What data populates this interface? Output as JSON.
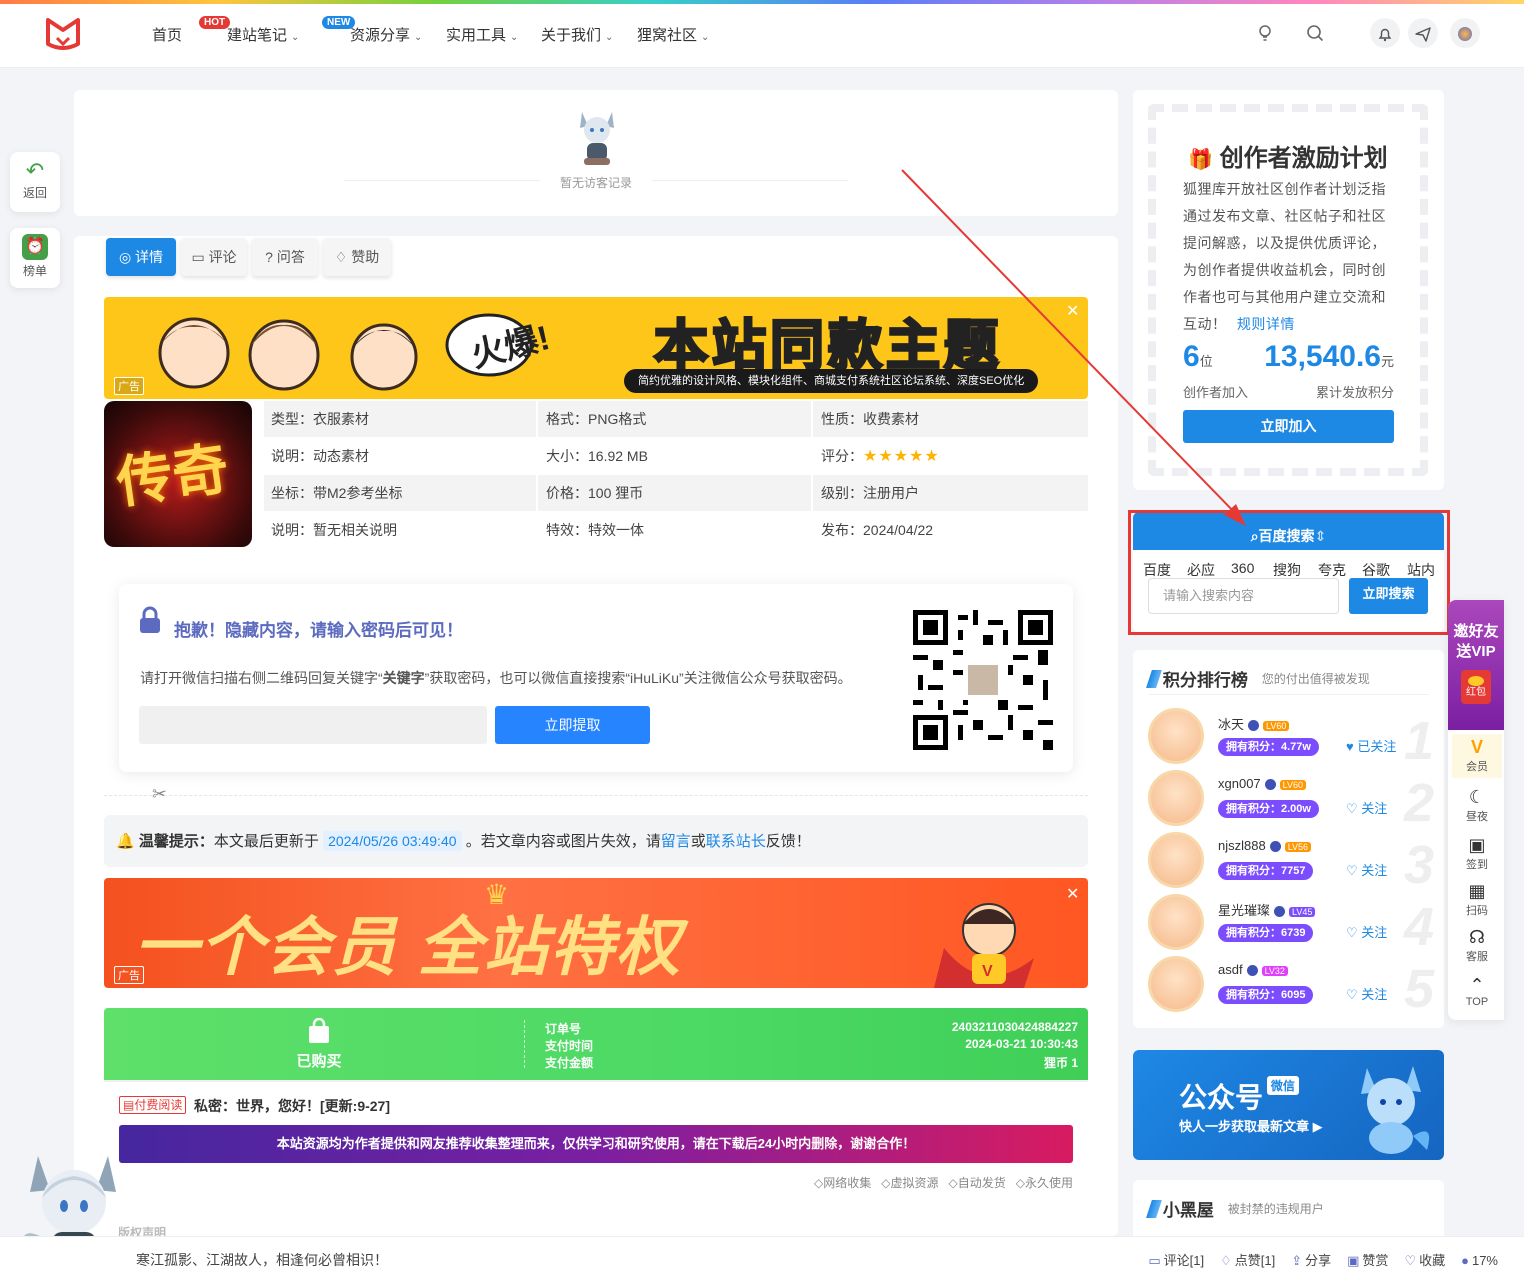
{
  "header": {
    "nav": [
      {
        "label": "首页",
        "chevron": false
      },
      {
        "label": "建站笔记",
        "chevron": true,
        "badge": "HOT"
      },
      {
        "label": "资源分享",
        "chevron": true,
        "badge": "NEW"
      },
      {
        "label": "实用工具",
        "chevron": true
      },
      {
        "label": "关于我们",
        "chevron": true
      },
      {
        "label": "狸窝社区",
        "chevron": true
      }
    ]
  },
  "left_float": {
    "back": "返回",
    "rank": "榜单"
  },
  "visitor": {
    "empty": "暂无访客记录"
  },
  "tabs": [
    "详情",
    "评论",
    "问答",
    "赞助"
  ],
  "ad1": {
    "headline": "本站同款主题",
    "sub": "简约优雅的设计风格、模块化组件、商城支付系统社区论坛系统、深度SEO优化",
    "bubble": "火爆!",
    "tag": "广告"
  },
  "meta": {
    "cover_text": "传奇",
    "rows": [
      [
        "类型：衣服素材",
        "格式：PNG格式",
        "性质：收费素材"
      ],
      [
        "说明：动态素材",
        "大小：16.92 MB",
        "评分："
      ],
      [
        "坐标：带M2参考坐标",
        "价格：100 狸币",
        "级别：注册用户"
      ],
      [
        "说明：暂无相关说明",
        "特效：特效一体",
        "发布：2024/04/22"
      ]
    ],
    "stars": "★★★★★"
  },
  "locked": {
    "title": "抱歉！隐藏内容，请输入密码后可见！",
    "desc_prefix": "请打开微信扫描右侧二维码回复关键字“",
    "keyword": "关键字",
    "desc_suffix": "”获取密码，也可以微信直接搜索“iHuLiKu”关注微信公众号获取密码。",
    "button": "立即提取"
  },
  "notice": {
    "label": "温馨提示：",
    "text1": "本文最后更新于",
    "date": "2024/05/26 03:49:40",
    "text2": "。若文章内容或图片失效，请",
    "link1": "留言",
    "or": "或",
    "link2": "联系站长",
    "text3": "反馈！"
  },
  "ad2": {
    "text": "一个会员 全站特权",
    "tag": "广告"
  },
  "purchase": {
    "status": "已购买",
    "labels": [
      "订单号",
      "支付时间",
      "支付金额"
    ],
    "values": [
      "2403211030424884227",
      "2024-03-21 10:30:43",
      "狸币 1"
    ]
  },
  "article": {
    "tag": "付费阅读",
    "title": "私密：世界，您好！[更新:9-27]",
    "disclaimer": "本站资源均为作者提供和网友推荐收集整理而来，仅供学习和研究使用，请在下载后24小时内删除，谢谢合作！",
    "tags": [
      "网络收集",
      "虚拟资源",
      "自动发货",
      "永久使用"
    ],
    "cutoff": "版权声明"
  },
  "creator": {
    "title": "创作者激励计划",
    "desc": "狐狸库开放社区创作者计划泛指通过发布文章、社区帖子和社区提问解惑，以及提供优质评论，为创作者提供收益机会，同时创作者也可与其他用户建立交流和互动！",
    "rule_link": "规则详情",
    "stat1_num": "6",
    "stat1_unit": "位",
    "stat1_label": "创作者加入",
    "stat2_num": "13,540.6",
    "stat2_unit": "元",
    "stat2_label": "累计发放积分",
    "button": "立即加入"
  },
  "search": {
    "title": "百度搜索",
    "engines": [
      "百度",
      "必应",
      "360",
      "搜狗",
      "夸克",
      "谷歌",
      "站内"
    ],
    "placeholder": "请输入搜索内容",
    "button": "立即搜索"
  },
  "ranking": {
    "title": "积分排行榜",
    "subtitle": "您的付出值得被发现",
    "items": [
      {
        "name": "冰天",
        "level": "LV60",
        "points": "拥有积分：4.77w",
        "follow": "已关注",
        "rank": "1"
      },
      {
        "name": "xgn007",
        "level": "LV60",
        "points": "拥有积分：2.00w",
        "follow": "关注",
        "rank": "2"
      },
      {
        "name": "njszl888",
        "level": "LV56",
        "points": "拥有积分：7757",
        "follow": "关注",
        "rank": "3"
      },
      {
        "name": "星光璀璨",
        "level": "LV45",
        "points": "拥有积分：6739",
        "follow": "关注",
        "rank": "4"
      },
      {
        "name": "asdf",
        "level": "LV32",
        "points": "拥有积分：6095",
        "follow": "关注",
        "rank": "5"
      }
    ]
  },
  "wechat": {
    "title": "公众号",
    "badge": "微信",
    "sub": "快人一步获取最新文章"
  },
  "blackhouse": {
    "title": "小黑屋",
    "subtitle": "被封禁的违规用户"
  },
  "right_float": {
    "invite": "邀好友送VIP",
    "hongbao": "红包",
    "items": [
      "会员",
      "昼夜",
      "签到",
      "扫码",
      "客服",
      "TOP"
    ]
  },
  "bottom": {
    "quote": "寒江孤影、江湖故人，相逢何必曾相识！",
    "actions": [
      "评论[1]",
      "点赞[1]",
      "分享",
      "赞赏",
      "收藏",
      "17%"
    ]
  },
  "colors": {
    "primary": "#1e88e5",
    "annotation": "#e53935",
    "purchase": "#4cd964"
  }
}
